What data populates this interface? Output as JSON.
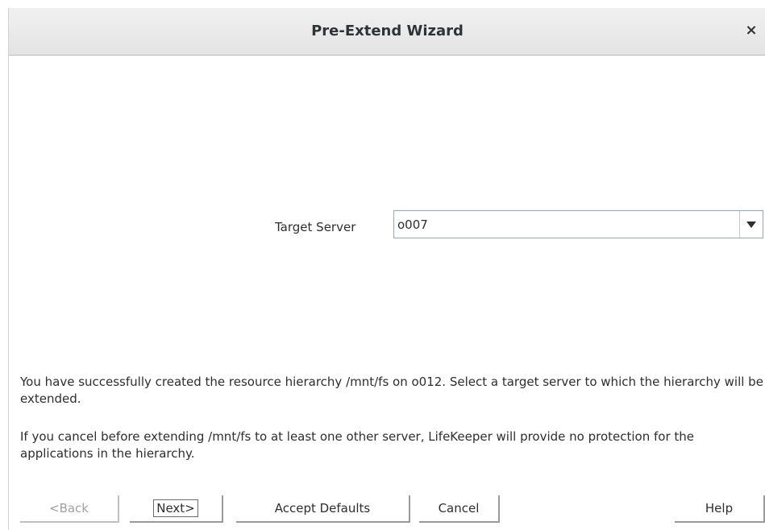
{
  "window": {
    "title": "Pre-Extend Wizard",
    "close_glyph": "×"
  },
  "form": {
    "target_server_label": "Target Server",
    "target_server_value": "o007"
  },
  "messages": {
    "line1": "You have successfully created the resource hierarchy /mnt/fs on o012. Select a target server to which the hierarchy will be extended.",
    "line2": "If you cancel before extending /mnt/fs to at least one other server, LifeKeeper will provide no protection for the applications in the hierarchy."
  },
  "buttons": {
    "back": "<Back",
    "next": "Next>",
    "accept_defaults": "Accept Defaults",
    "cancel": "Cancel",
    "help": "Help"
  },
  "icons": {
    "close": "close-icon",
    "dropdown": "chevron-down-icon"
  }
}
